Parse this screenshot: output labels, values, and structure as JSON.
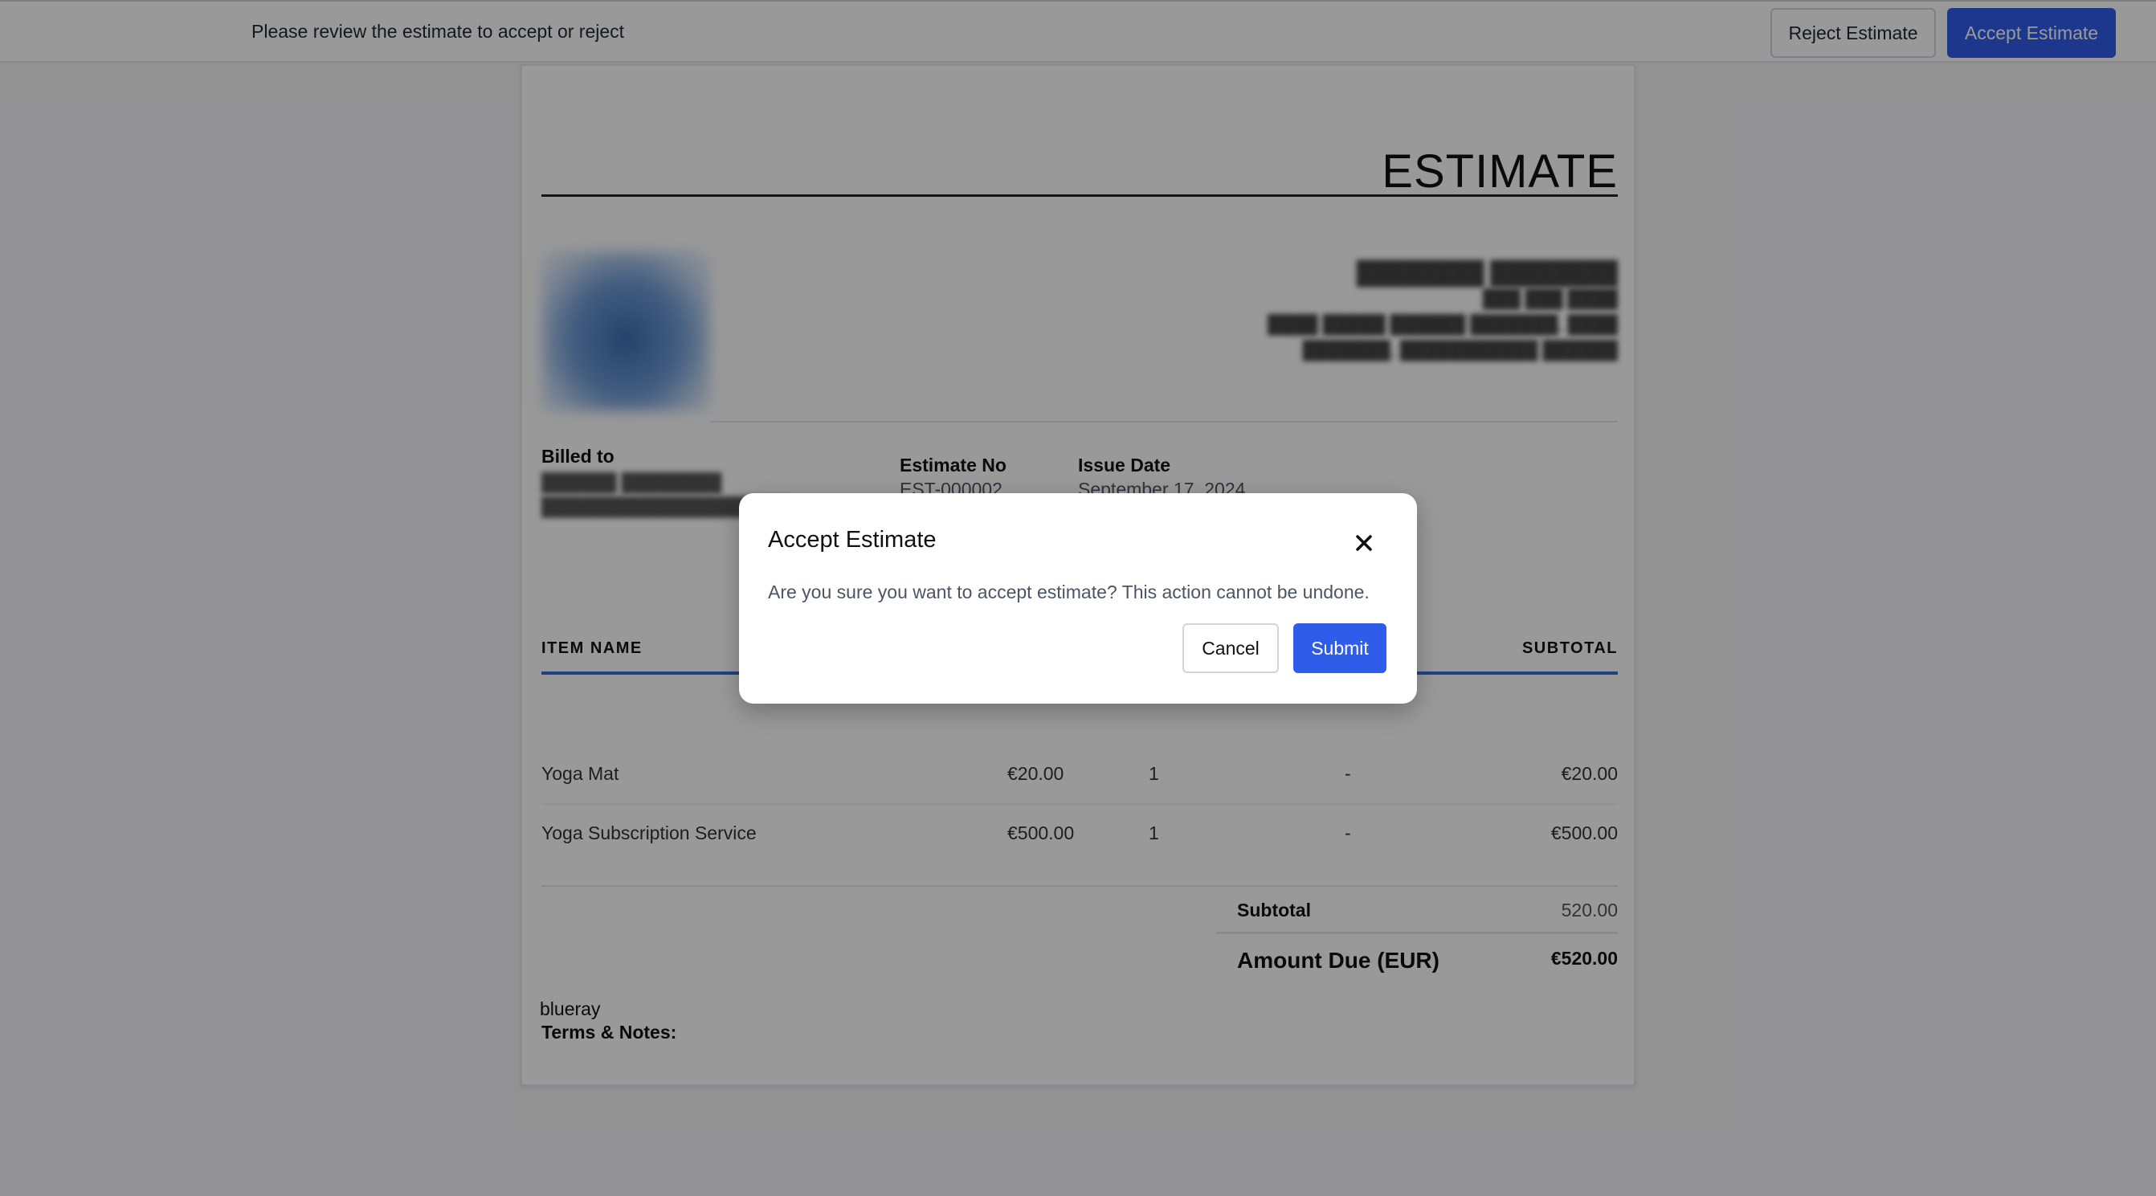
{
  "topbar": {
    "message": "Please review the estimate to accept or reject",
    "reject_label": "Reject Estimate",
    "accept_label": "Accept Estimate"
  },
  "document": {
    "title": "ESTIMATE",
    "billed_to_label": "Billed to",
    "estimate_no_label": "Estimate No",
    "estimate_no": "EST-000002",
    "issue_date_label": "Issue Date",
    "issue_date": "September 17, 2024",
    "table": {
      "headers": {
        "item_name": "ITEM NAME",
        "subtotal": "SUBTOTAL"
      },
      "rows": [
        {
          "item": "Yoga Mat",
          "price": "€20.00",
          "qty": "1",
          "discount": "-",
          "subtotal": "€20.00"
        },
        {
          "item": "Yoga Subscription Service",
          "price": "€500.00",
          "qty": "1",
          "discount": "-",
          "subtotal": "€500.00"
        }
      ]
    },
    "totals": {
      "subtotal_label": "Subtotal",
      "subtotal_value": "520.00",
      "amount_due_label": "Amount Due (EUR)",
      "amount_due_value": "€520.00"
    },
    "terms_label": "Terms & Notes:",
    "terms_value": "blueray"
  },
  "modal": {
    "title": "Accept Estimate",
    "message": "Are you sure you want to accept estimate? This action cannot be undone.",
    "cancel_label": "Cancel",
    "submit_label": "Submit"
  },
  "colors": {
    "primary": "#2f5ce8",
    "table_header_rule": "#3b6bd6",
    "overlay": "rgba(0,0,0,0.40)"
  },
  "icons": {
    "close": "close-icon"
  }
}
